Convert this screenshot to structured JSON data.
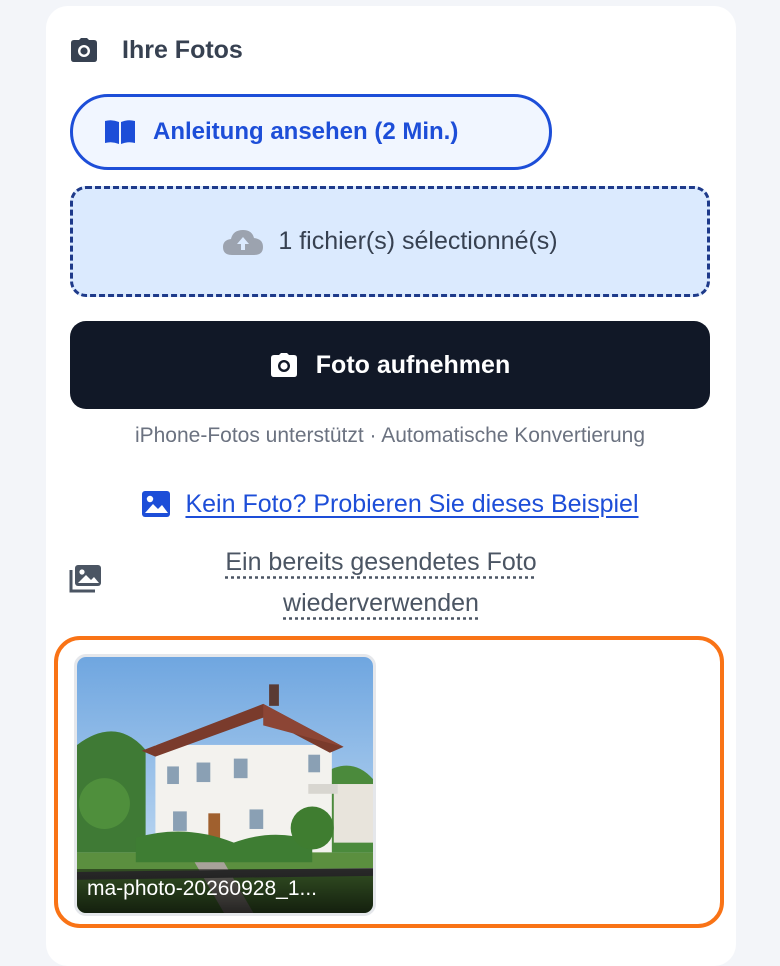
{
  "header": {
    "title": "Ihre Fotos",
    "icon": "camera-icon"
  },
  "guide_button": {
    "label": "Anleitung ansehen (2 Min.)",
    "icon": "book-open-icon",
    "color": "#1d4ed8"
  },
  "dropzone": {
    "label": "1 fichier(s) sélectionné(s)",
    "icon": "cloud-upload-icon"
  },
  "capture_button": {
    "label": "Foto aufnehmen",
    "icon": "camera-icon"
  },
  "hint": "iPhone-Fotos unterstützt · Automatische Konvertierung",
  "sample_link": {
    "label": "Kein Foto? Probieren Sie dieses Beispiel",
    "icon": "image-icon"
  },
  "reuse_link": {
    "label": "Ein bereits gesendetes Foto wiederverwenden",
    "icon": "photo-library-icon"
  },
  "gallery": {
    "highlight_color": "#f97316",
    "photos": [
      {
        "caption": "ma-photo-20260928_1..."
      }
    ]
  }
}
